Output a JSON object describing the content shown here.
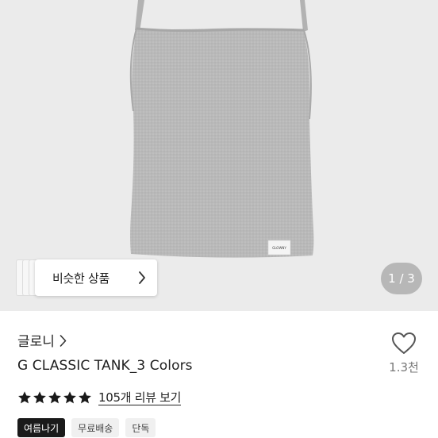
{
  "product": {
    "label_text": "GLOWNY",
    "similar_button_label": "비슷한 상품",
    "image_counter": "1 / 3",
    "brand": "글로니",
    "title": "G CLASSIC TANK_3 Colors",
    "like_count": "1.3천",
    "rating": 5,
    "review_link": "105개 리뷰 보기",
    "tags": [
      "여름나기",
      "무료배송",
      "단독"
    ]
  },
  "colors": {
    "hero_bg": "#ebebeb",
    "tank_gray": "#b9b9b9",
    "star": "#1a1a1a",
    "tag_dark_bg": "#1a1a1a",
    "tag_light_bg": "#f0f0f0"
  },
  "icons": [
    "chevron-right-icon",
    "heart-outline-icon",
    "star-icon"
  ]
}
